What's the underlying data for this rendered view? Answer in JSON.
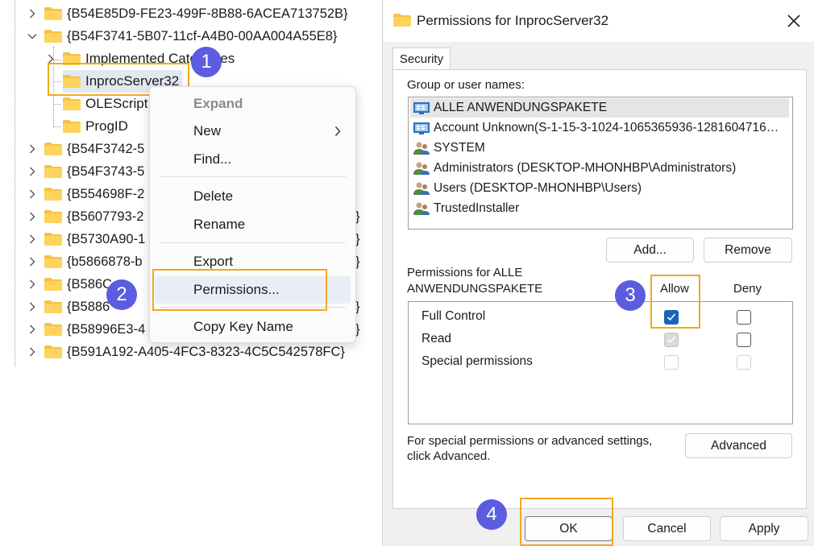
{
  "tree": {
    "top_item": "{B54E85D9-FE23-499F-8B88-6ACEA713752B}",
    "expanded_item": "{B54F3741-5B07-11cf-A4B0-00AA004A55E8}",
    "children": [
      "Implemented Categories",
      "InprocServer32",
      "OLEScript",
      "ProgID"
    ],
    "items": [
      "{B54F3742-5",
      "{B54F3743-5",
      "{B554698F-2",
      "{B5607793-2",
      "{B5730A90-1",
      "{b5866878-b",
      "{B586C",
      "{B5886",
      "{B58996E3-4"
    ],
    "items_tail": [
      "",
      "",
      "",
      "}",
      "}",
      "}",
      "",
      "}",
      "}"
    ],
    "last_item": "{B591A192-A405-4FC3-8323-4C5C542578FC}"
  },
  "context_menu": {
    "expand": "Expand",
    "new": "New",
    "find": "Find...",
    "delete": "Delete",
    "rename": "Rename",
    "export": "Export",
    "permissions": "Permissions...",
    "copy_key_name": "Copy Key Name"
  },
  "badges": {
    "b1": "1",
    "b2": "2",
    "b3": "3",
    "b4": "4"
  },
  "dialog": {
    "title": "Permissions for InprocServer32",
    "tab": "Security",
    "group_label": "Group or user names:",
    "users": [
      "ALLE ANWENDUNGSPAKETE",
      "Account Unknown(S-1-15-3-1024-1065365936-1281604716…",
      "SYSTEM",
      "Administrators (DESKTOP-MHONHBP\\Administrators)",
      "Users (DESKTOP-MHONHBP\\Users)",
      "TrustedInstaller"
    ],
    "add_button": "Add...",
    "remove_button": "Remove",
    "perms_for_line1": "Permissions for ALLE",
    "perms_for_line2": "ANWENDUNGSPAKETE",
    "allow_header": "Allow",
    "deny_header": "Deny",
    "permissions": [
      {
        "name": "Full Control",
        "allow": true,
        "deny": false
      },
      {
        "name": "Read",
        "allow": true,
        "deny": false
      },
      {
        "name": "Special permissions",
        "allow": false,
        "deny": false
      }
    ],
    "special_text_line1": "For special permissions or advanced settings,",
    "special_text_line2": "click Advanced.",
    "advanced_button": "Advanced",
    "ok_button": "OK",
    "cancel_button": "Cancel",
    "apply_button": "Apply"
  },
  "colors": {
    "highlight": "#f2a81d",
    "badge": "#5b5ce0",
    "checkbox_checked": "#1a64b8",
    "folder": "#f5c242"
  }
}
